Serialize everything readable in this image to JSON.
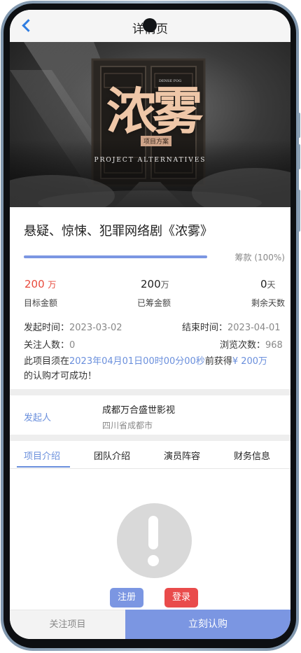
{
  "header": {
    "title": "详情页"
  },
  "banner": {
    "logo": "浓雾",
    "seal": "项目方案",
    "eng": "PROJECT ALTERNATIVES",
    "tiny": "DENSE FOG"
  },
  "project": {
    "title": "悬疑、惊悚、犯罪网络剧《浓雾》",
    "progress": {
      "percent": 100,
      "label": "筹款 (100%)"
    },
    "stats": [
      {
        "value": "200",
        "unit": "万",
        "label": "目标金额"
      },
      {
        "value": "200",
        "unit": "万",
        "label": "已筹金额"
      },
      {
        "value": "0",
        "unit": "天",
        "label": "剩余天数"
      }
    ],
    "start": {
      "label": "发起时间：",
      "value": "2023-03-02"
    },
    "end": {
      "label": "结束时间：",
      "value": "2023-04-01"
    },
    "followers": {
      "label": "关注人数：",
      "value": "0"
    },
    "views": {
      "label": "浏览次数：",
      "value": "968"
    },
    "notice": {
      "prefix": "此项目须在",
      "deadline": "2023年04月01日00时00分00秒",
      "middle": "前获得",
      "amount": "¥ 200万",
      "suffix": "的认购才可成功！"
    }
  },
  "launcher": {
    "label": "发起人",
    "name": "成都万合盛世影视",
    "location": "四川省成都市"
  },
  "tabs": [
    "项目介绍",
    "团队介绍",
    "演员阵容",
    "财务信息"
  ],
  "actions": {
    "register": "注册",
    "login": "登录"
  },
  "bottom": {
    "follow": "关注项目",
    "subscribe": "立刻认购"
  },
  "colors": {
    "accent": "#7b96e2",
    "red": "#e84a3c",
    "login": "#e94b4b"
  }
}
